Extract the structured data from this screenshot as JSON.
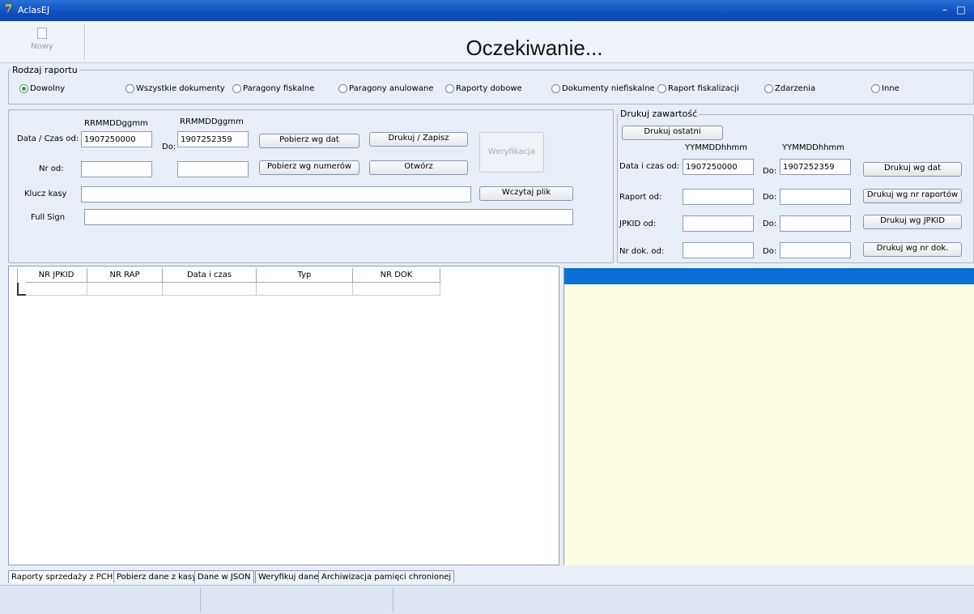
{
  "window": {
    "title": "AclasEJ",
    "minimize": "–",
    "maximize": "□"
  },
  "toolbar": {
    "new_label": "Nowy",
    "status": "Oczekiwanie..."
  },
  "report_type": {
    "legend": "Rodzaj raportu",
    "options": [
      {
        "label": "Dowolny",
        "selected": true
      },
      {
        "label": "Wszystkie dokumenty",
        "selected": false
      },
      {
        "label": "Paragony fiskalne",
        "selected": false
      },
      {
        "label": "Paragony anulowane",
        "selected": false
      },
      {
        "label": "Raporty dobowe",
        "selected": false
      },
      {
        "label": "Dokumenty niefiskalne",
        "selected": false
      },
      {
        "label": "Raport fiskalizacji",
        "selected": false
      },
      {
        "label": "Zdarzenia",
        "selected": false
      },
      {
        "label": "Inne",
        "selected": false
      }
    ]
  },
  "left_panel": {
    "format_from": "RRMMDDggmm",
    "format_to": "RRMMDDggmm",
    "date_from_label": "Data / Czas od:",
    "date_from_value": "1907250000",
    "to_label": "Do:",
    "date_to_value": "1907252359",
    "nr_from_label": "Nr od:",
    "nr_from_value": "",
    "nr_to_value": "",
    "key_label": "Klucz kasy",
    "key_value": "",
    "sign_label": "Full Sign",
    "sign_value": "",
    "btn_fetch_dates": "Pobierz wg dat",
    "btn_fetch_numbers": "Pobierz wg numerów",
    "btn_print_save": "Drukuj / Zapisz",
    "btn_open": "Otwórz",
    "btn_verify": "Weryfikacja",
    "btn_load_file": "Wczytaj plik"
  },
  "print_panel": {
    "legend": "Drukuj zawartość",
    "btn_print_last": "Drukuj ostatni",
    "format_from": "YYMMDDhhmm",
    "format_to": "YYMMDDhhmm",
    "date_label": "Data i czas od:",
    "date_from_value": "1907250000",
    "to_label": "Do:",
    "date_to_value": "1907252359",
    "report_label": "Raport od:",
    "jpkid_label": "JPKID od:",
    "doc_label": "Nr dok. od:",
    "btn_print_dates": "Drukuj wg dat",
    "btn_print_reports": "Drukuj wg nr raportów",
    "btn_print_jpkid": "Drukuj wg JPKID",
    "btn_print_doc": "Drukuj wg nr dok."
  },
  "grid": {
    "columns": [
      "NR JPKID",
      "NR RAP",
      "Data i czas",
      "Typ",
      "NR DOK"
    ]
  },
  "tabs": [
    "Raporty sprzedaży z PCH",
    "Pobierz dane z kasy",
    "Dane w JSON",
    "Weryfikuj dane",
    "Archiwizacja pamięci chronionej"
  ],
  "colors": {
    "titlebar": "#0f4fc0",
    "preview_header": "#0b6fd8",
    "preview_bg": "#fcfce2",
    "selected_radio": "#2fa52f"
  }
}
